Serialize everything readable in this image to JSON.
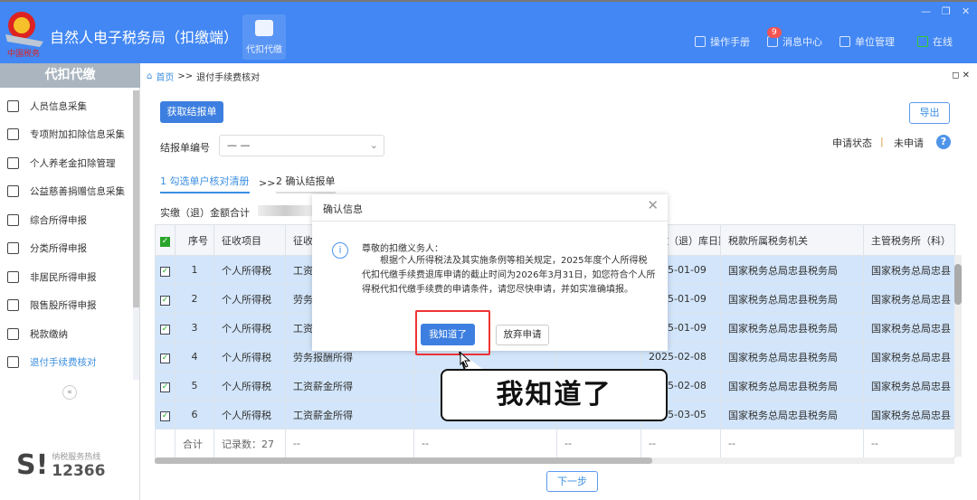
{
  "app": {
    "title": "自然人电子税务局（扣缴端）",
    "logo_text": "中国税务",
    "module": "代扣代缴",
    "window_controls": [
      "minimize",
      "restore",
      "close"
    ]
  },
  "toplinks": [
    {
      "label": "操作手册",
      "icon": "manual-icon"
    },
    {
      "label": "消息中心",
      "icon": "mail-icon",
      "badge": "9"
    },
    {
      "label": "单位管理",
      "icon": "building-icon"
    },
    {
      "label": "在线",
      "icon": "monitor-check-icon"
    }
  ],
  "sidebar": {
    "title": "代扣代缴",
    "items": [
      {
        "label": "人员信息采集"
      },
      {
        "label": "专项附加扣除信息采集"
      },
      {
        "label": "个人养老金扣除管理"
      },
      {
        "label": "公益慈善捐赠信息采集"
      },
      {
        "label": "综合所得申报"
      },
      {
        "label": "分类所得申报"
      },
      {
        "label": "非居民所得申报"
      },
      {
        "label": "限售股所得申报"
      },
      {
        "label": "税款缴纳"
      },
      {
        "label": "退付手续费核对",
        "active": true
      }
    ],
    "collapse": "«",
    "hotline_label": "纳税服务热线",
    "hotline": "12366"
  },
  "breadcrumb": {
    "home": "首页",
    "sep": ">>",
    "current": "退付手续费核对"
  },
  "main": {
    "get_btn": "获取结报单",
    "export_btn": "导出",
    "report_no_label": "结报单编号",
    "report_no_value": "— —",
    "status_label": "申请状态",
    "status_sep": "|",
    "status_value": "未申请",
    "step1": "1 勾选单户核对清册",
    "step_sep": ">>",
    "step2": "2 确认结报单",
    "total_label": "实缴（退）金额合计",
    "next_btn": "下一步"
  },
  "table": {
    "headers": [
      "",
      "序号",
      "征收项目",
      "征收品目",
      "",
      "",
      "实缴（退）库日期",
      "税款所属税务机关",
      "主管税务所（科）"
    ],
    "rows": [
      [
        "1",
        "个人所得税",
        "工资薪金所得",
        "",
        "",
        "2025-01-09",
        "国家税务总局忠县税务局",
        "国家税务总局忠县"
      ],
      [
        "2",
        "个人所得税",
        "劳务报酬所得",
        "",
        "",
        "2025-01-09",
        "国家税务总局忠县税务局",
        "国家税务总局忠县"
      ],
      [
        "3",
        "个人所得税",
        "工资薪金所得",
        "",
        "",
        "2025-01-09",
        "国家税务总局忠县税务局",
        "国家税务总局忠县"
      ],
      [
        "4",
        "个人所得税",
        "劳务报酬所得",
        "",
        "",
        "2025-02-08",
        "国家税务总局忠县税务局",
        "国家税务总局忠县"
      ],
      [
        "5",
        "个人所得税",
        "工资薪金所得",
        "",
        "",
        "2025-02-08",
        "国家税务总局忠县税务局",
        "国家税务总局忠县"
      ],
      [
        "6",
        "个人所得税",
        "工资薪金所得",
        "",
        "",
        "2025-03-05",
        "国家税务总局忠县税务局",
        "国家税务总局忠县"
      ]
    ],
    "footer": [
      "合计",
      "记录数：27",
      "--",
      "--",
      "--",
      "--",
      "--",
      "--"
    ]
  },
  "dialog": {
    "title": "确认信息",
    "greeting": "尊敬的扣缴义务人：",
    "body": "根据个人所得税法及其实施条例等相关规定，2025年度个人所得税代扣代缴手续费退库申请的截止时间为2026年3月31日，如您符合个人所得税代扣代缴手续费的申请条件，请您尽快申请，并如实准确填报。",
    "ok": "我知道了",
    "cancel": "放弃申请"
  },
  "callout": {
    "text": "我知道了"
  },
  "colors": {
    "brand": "#4287f3",
    "primary": "#3d7fe0",
    "selected_row": "#d2e5fa",
    "highlight": "#e33333"
  }
}
